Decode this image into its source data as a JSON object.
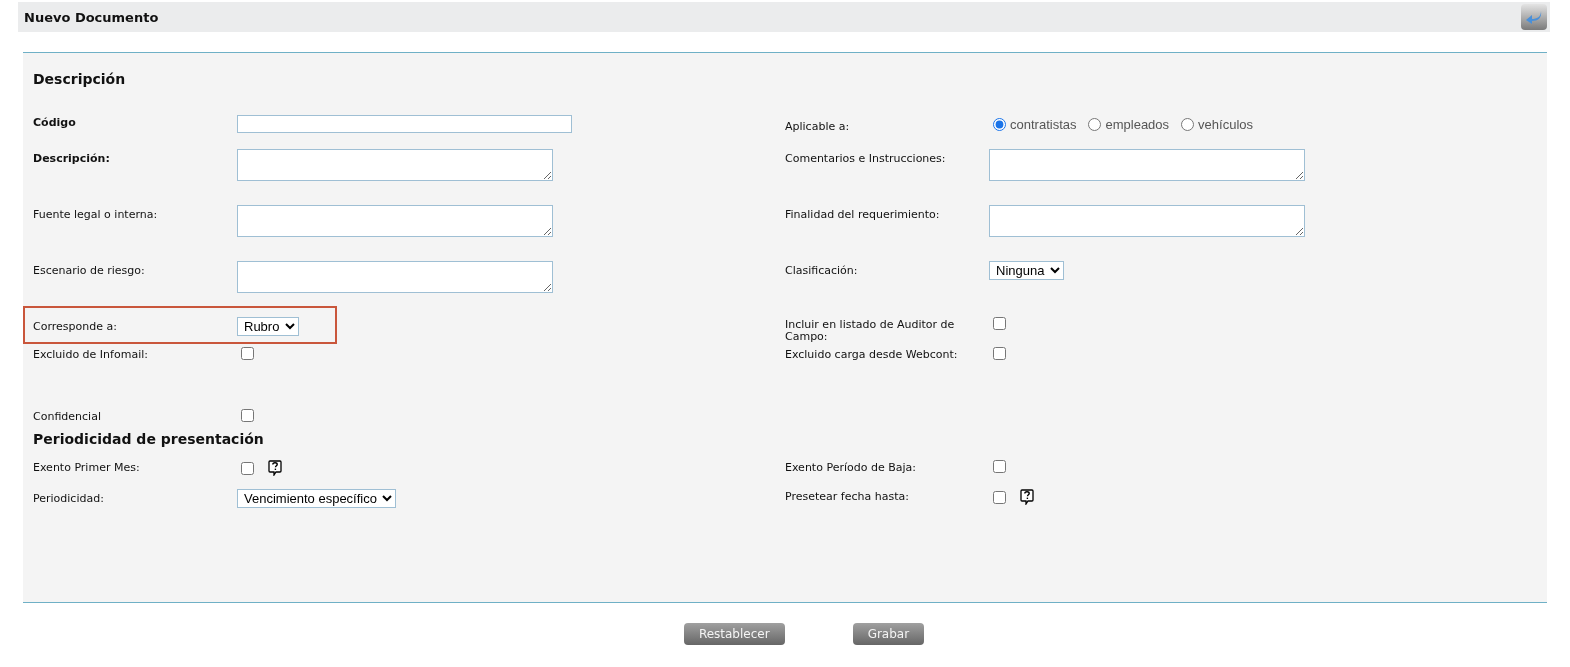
{
  "header": {
    "title": "Nuevo Documento"
  },
  "sections": [
    {
      "title": "Descripción",
      "rows": [
        {
          "left": {
            "label": "Código",
            "required": true,
            "control": {
              "kind": "input"
            }
          },
          "right": {
            "label": "Aplicable a:",
            "required": false,
            "control": {
              "kind": "radio",
              "options": [
                {
                  "label": "contratistas",
                  "selected": true
                },
                {
                  "label": "empleados",
                  "selected": false
                },
                {
                  "label": "vehículos",
                  "selected": false
                }
              ]
            }
          }
        },
        {
          "left": {
            "label": "Descripción:",
            "required": true,
            "control": {
              "kind": "textarea"
            }
          },
          "right": {
            "label": "Comentarios e Instrucciones:",
            "required": false,
            "control": {
              "kind": "textarea"
            }
          }
        },
        {
          "left": {
            "label": "Fuente legal o interna:",
            "required": false,
            "control": {
              "kind": "textarea"
            }
          },
          "right": {
            "label": "Finalidad del requerimiento:",
            "required": false,
            "control": {
              "kind": "textarea"
            }
          }
        },
        {
          "left": {
            "label": "Escenario de riesgo:",
            "required": false,
            "control": {
              "kind": "textarea"
            }
          },
          "right": {
            "label": "Clasificación:",
            "required": false,
            "control": {
              "kind": "select",
              "value": "Ninguna"
            }
          }
        },
        {
          "highlighted": true,
          "left": {
            "label": "Corresponde a:",
            "required": false,
            "control": {
              "kind": "select",
              "value": "Rubro"
            }
          },
          "right": {
            "label": "Incluir en listado de Auditor de Campo:",
            "required": false,
            "control": {
              "kind": "checkbox",
              "checked": false
            }
          }
        },
        {
          "left": {
            "label": "Excluido de Infomail:",
            "required": false,
            "control": {
              "kind": "checkbox",
              "checked": false
            }
          },
          "right": {
            "label": "Excluido carga desde Webcont:",
            "required": false,
            "control": {
              "kind": "checkbox",
              "checked": false
            }
          }
        },
        {
          "left": {
            "label": "Confidencial",
            "required": false,
            "control": {
              "kind": "checkbox",
              "checked": false
            }
          }
        }
      ]
    },
    {
      "title": "Periodicidad de presentación",
      "rows": [
        {
          "left": {
            "label": "Exento Primer Mes:",
            "required": false,
            "control": {
              "kind": "checkbox",
              "checked": false,
              "help": true
            }
          },
          "right": {
            "label": "Exento Período de Baja:",
            "required": false,
            "control": {
              "kind": "checkbox",
              "checked": false
            }
          }
        },
        {
          "left": {
            "label": "Periodicidad:",
            "required": false,
            "control": {
              "kind": "select",
              "value": "Vencimiento específico"
            }
          },
          "right": {
            "label": "Presetear fecha hasta:",
            "required": false,
            "control": {
              "kind": "checkbox",
              "checked": false,
              "help": true
            }
          }
        }
      ]
    }
  ],
  "buttons": [
    "Restablecer",
    "Grabar"
  ]
}
